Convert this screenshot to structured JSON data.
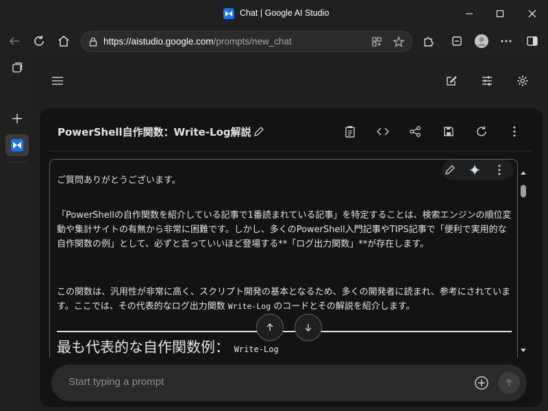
{
  "window": {
    "title": "Chat | Google AI Studio"
  },
  "browser": {
    "url_host": "https://aistudio.google.com",
    "url_path": "/prompts/new_chat"
  },
  "chat": {
    "title": "PowerShell自作関数：Write-Log解説"
  },
  "message": {
    "p1": "ご質問ありがとうございます。",
    "p2": "「PowerShellの自作関数を紹介している記事で1番読まれている記事」を特定することは、検索エンジンの順位変動や集計サイトの有無から非常に困難です。しかし、多くのPowerShell入門記事やTIPS記事で「便利で実用的な自作関数の例」として、必ずと言っていいほど登場する**「ログ出力関数」**が存在します。",
    "p3_before": "この関数は、汎用性が非常に高く、スクリプト開発の基本となるため、多くの開発者に読まれ、参考にされています。ここでは、その代表的なログ出力関数 ",
    "p3_code": "Write-Log",
    "p3_after": " のコードとその解説を紹介します。",
    "heading": "最も代表的な自作関数例：",
    "heading_code": "Write-Log"
  },
  "prompt": {
    "placeholder": "Start typing a prompt"
  },
  "colors": {
    "accent": "#1a73e8",
    "background": "#131314",
    "surface": "#1e1f20",
    "text": "#e3e3e3"
  }
}
